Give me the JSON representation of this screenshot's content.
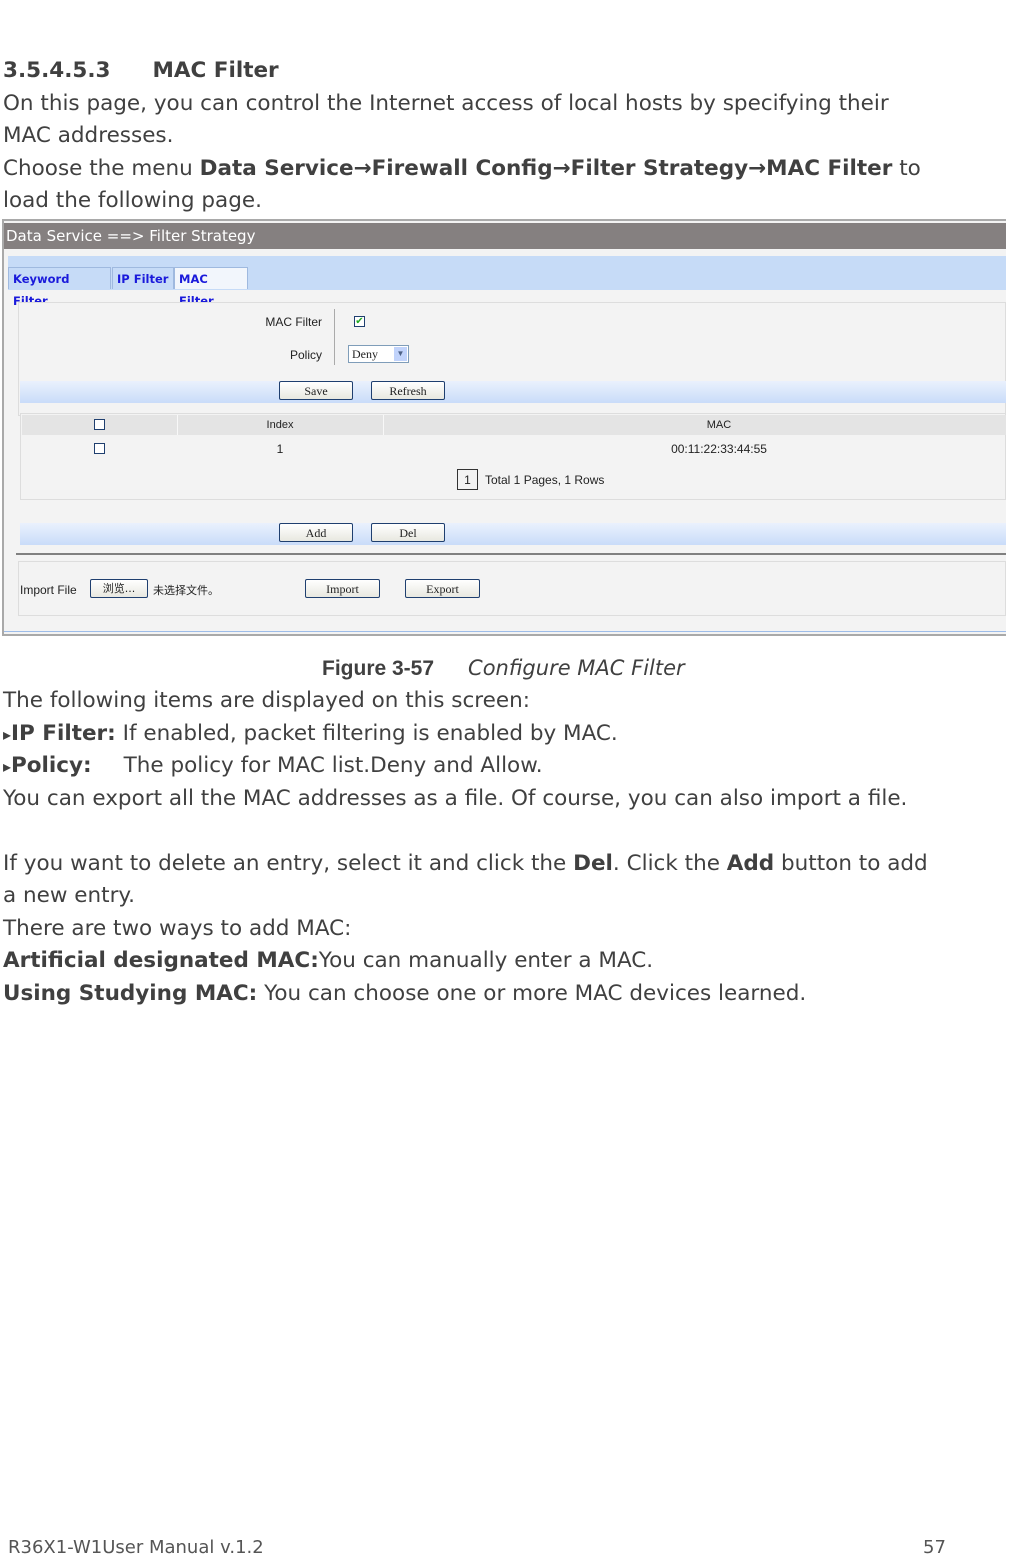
{
  "heading": {
    "number": "3.5.4.5.3",
    "title": "MAC Filter"
  },
  "intro": "On this page, you can control the Internet access of local hosts by specifying their MAC addresses.",
  "intro_line1": "On this page, you can control the Internet access of local hosts by specifying their",
  "intro_line2": "MAC addresses.",
  "menu": {
    "prefix": "Choose the menu ",
    "path": "Data Service→Firewall Config→Filter Strategy→MAC Filter",
    "suffix": " to",
    "line2": "load the following page."
  },
  "screenshot": {
    "title": "Data Service ==> Filter Strategy",
    "tabs": [
      "Keyword Filter",
      "IP Filter",
      "MAC Filter"
    ],
    "active_tab": "MAC Filter",
    "mac_filter_label": "MAC Filter",
    "mac_filter_checked": true,
    "policy_label": "Policy",
    "policy_value": "Deny",
    "save": "Save",
    "refresh": "Refresh",
    "table": {
      "headers": [
        "",
        "Index",
        "MAC"
      ],
      "rows": [
        {
          "index": "1",
          "mac": "00:11:22:33:44:55"
        }
      ]
    },
    "page": "1",
    "pager_text": "Total 1 Pages, 1 Rows",
    "add": "Add",
    "del": "Del",
    "import_label": "Import File",
    "browse": "浏览...",
    "no_file": "未选择文件。",
    "import": "Import",
    "export": "Export"
  },
  "caption": {
    "label": "Figure 3-57",
    "title": "Configure MAC Filter"
  },
  "body": {
    "items_intro": "The following items are displayed on this screen:",
    "ip_filter_label": "IP Filter:",
    "ip_filter_text": " If enabled, packet filtering is enabled by MAC.",
    "policy_label": "Policy:",
    "policy_text": "The policy for MAC list.Deny and Allow.",
    "export_text": "You can export all the MAC addresses as a file. Of course, you can also import a file.",
    "del_1": "If you want to delete an entry, select it and click the ",
    "del_b": "Del",
    "del_2": ". Click the ",
    "add_b": "Add",
    "del_3": " button to add",
    "del_line2": "a new entry.",
    "ways": "There are two ways to add MAC:",
    "art_label": "Artificial designated MAC:",
    "art_text": "You can manually enter a MAC.",
    "study_label": "Using Studying MAC:",
    "study_text": " You can choose one or more MAC devices learned."
  },
  "footer": {
    "manual": "R36X1-W1User Manual v.1.2",
    "page": "57"
  }
}
